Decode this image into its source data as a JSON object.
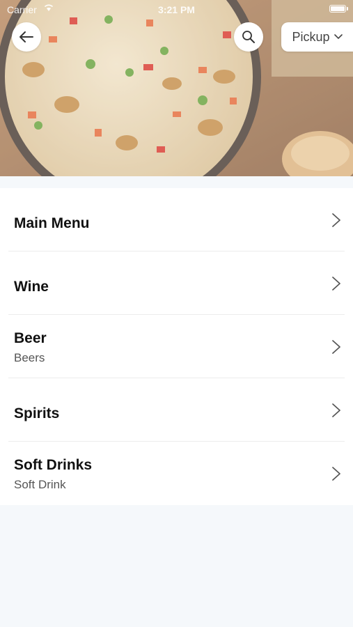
{
  "status_bar": {
    "carrier": "Carrier",
    "time": "3:21 PM"
  },
  "header": {
    "back_icon": "arrow-left-icon",
    "search_icon": "search-icon",
    "pickup_label": "Pickup",
    "pickup_icon": "chevron-down-icon",
    "hero_image": "fried-rice-photo"
  },
  "menu": {
    "items": [
      {
        "title": "Main Menu",
        "subtitle": ""
      },
      {
        "title": "Wine",
        "subtitle": ""
      },
      {
        "title": "Beer",
        "subtitle": "Beers"
      },
      {
        "title": "Spirits",
        "subtitle": ""
      },
      {
        "title": "Soft Drinks",
        "subtitle": "Soft Drink"
      }
    ]
  },
  "colors": {
    "page_background": "#f5f8fb",
    "card_background": "#ffffff",
    "title_text": "#111111",
    "subtitle_text": "#555555"
  }
}
